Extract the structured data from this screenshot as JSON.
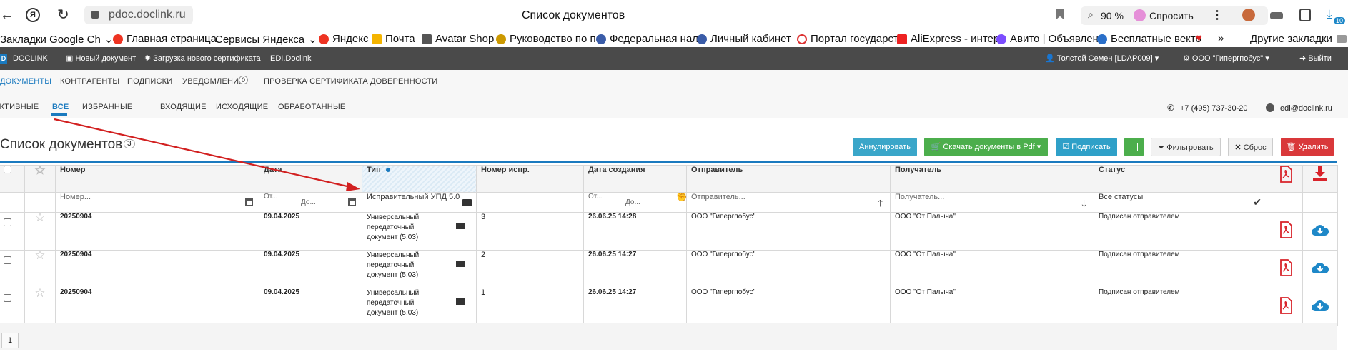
{
  "browser": {
    "url": "pdoc.doclink.ru",
    "page_title": "Список документов",
    "zoom": "90 %",
    "ask_label": "Спросить",
    "badge_count": "10"
  },
  "bookmarks": [
    {
      "label": "Закладки Google Ch",
      "icon": "folder-icon"
    },
    {
      "label": "Главная страница",
      "icon": "yandex-icon"
    },
    {
      "label": "Сервисы Яндекса",
      "icon": "none"
    },
    {
      "label": "Яндекс",
      "icon": "yandex-icon"
    },
    {
      "label": "Почта",
      "icon": "mail-icon"
    },
    {
      "label": "Avatar Shop",
      "icon": "shop-icon"
    },
    {
      "label": "Руководство по п",
      "icon": "gear-icon"
    },
    {
      "label": "Федеральная нал",
      "icon": "emblem-icon"
    },
    {
      "label": "Личный кабинет",
      "icon": "emblem-icon"
    },
    {
      "label": "Портал государст",
      "icon": "portal-icon"
    },
    {
      "label": "AliExpress - интер",
      "icon": "aliexpress-icon"
    },
    {
      "label": "Авито | Объявлен",
      "icon": "avito-icon"
    },
    {
      "label": "Бесплатные векто",
      "icon": "vector-icon"
    },
    {
      "label": "Другие закладки",
      "icon": "folder-icon"
    }
  ],
  "appbar": {
    "logo": "DOCLINK",
    "new_doc": "Новый документ",
    "upload_cert": "Загрузка нового сертификата",
    "edi": "EDI.Doclink",
    "user": "Толстой Семен [LDAP009]",
    "org": "ООО \"Гипергпобус\"",
    "logout": "Выйти"
  },
  "nav": {
    "main_tabs": [
      "ДОКУМЕНТЫ",
      "КОНТРАГЕНТЫ",
      "ПОДПИСКИ",
      "УВЕДОМЛЕНИЯ",
      "ПРОВЕРКА СЕРТИФИКАТА",
      "ДОВЕРЕННОСТИ"
    ],
    "notifications_count": "0",
    "sub_tabs": [
      "АКТИВНЫЕ",
      "ВСЕ",
      "ИЗБРАННЫЕ",
      "ВХОДЯЩИЕ",
      "ИСХОДЯЩИЕ",
      "ОБРАБОТАННЫЕ"
    ],
    "phone": "+7 (495) 737-30-20",
    "email": "edi@doclink.ru"
  },
  "page": {
    "heading": "Список документов",
    "count": "3"
  },
  "toolbar": {
    "annul": "Аннулировать",
    "download_pdf": "Скачать документы в Pdf",
    "sign": "Подписать",
    "filter": "Фильтровать",
    "reset": "Сброс",
    "delete": "Удалить"
  },
  "table": {
    "headers": [
      "Номер",
      "Дата",
      "Тип",
      "Номер испр.",
      "Дата создания",
      "Отправитель",
      "Получатель",
      "Статус"
    ],
    "filters": {
      "number_ph": "Номер...",
      "date_from": "От...",
      "date_to": "До...",
      "type_value": "Исправительный УПД 5.0",
      "created_from": "От...",
      "created_to": "До...",
      "sender_ph": "Отправитель...",
      "receiver_ph": "Получатель...",
      "status_value": "Все статусы"
    },
    "rows": [
      {
        "number": "20250904",
        "date": "09.04.2025",
        "type_l1": "Универсальный",
        "type_l2": "передаточный",
        "type_l3": "документ (5.03)",
        "corr": "3",
        "created": "26.06.25 14:28",
        "sender": "ООО \"Гипергпобус\"",
        "receiver": "ООО \"От Палыча\"",
        "status": "Подписан отправителем"
      },
      {
        "number": "20250904",
        "date": "09.04.2025",
        "type_l1": "Универсальный",
        "type_l2": "передаточный",
        "type_l3": "документ (5.03)",
        "corr": "2",
        "created": "26.06.25 14:27",
        "sender": "ООО \"Гипергпобус\"",
        "receiver": "ООО \"От Палыча\"",
        "status": "Подписан отправителем"
      },
      {
        "number": "20250904",
        "date": "09.04.2025",
        "type_l1": "Универсальный",
        "type_l2": "передаточный",
        "type_l3": "документ (5.03)",
        "corr": "1",
        "created": "26.06.25 14:27",
        "sender": "ООО \"Гипергпобус\"",
        "receiver": "ООО \"От Палыча\"",
        "status": "Подписан отправителем"
      }
    ]
  },
  "pagination": {
    "page": "1"
  },
  "colors": {
    "accent_blue": "#1a7abf",
    "annul": "#3aa6c9",
    "download": "#4cae4c",
    "sign": "#2fa0c8",
    "delete": "#d9383a",
    "pdf_red": "#d8232a",
    "download_blue": "#1e88c8",
    "arrow": "#d22020"
  }
}
